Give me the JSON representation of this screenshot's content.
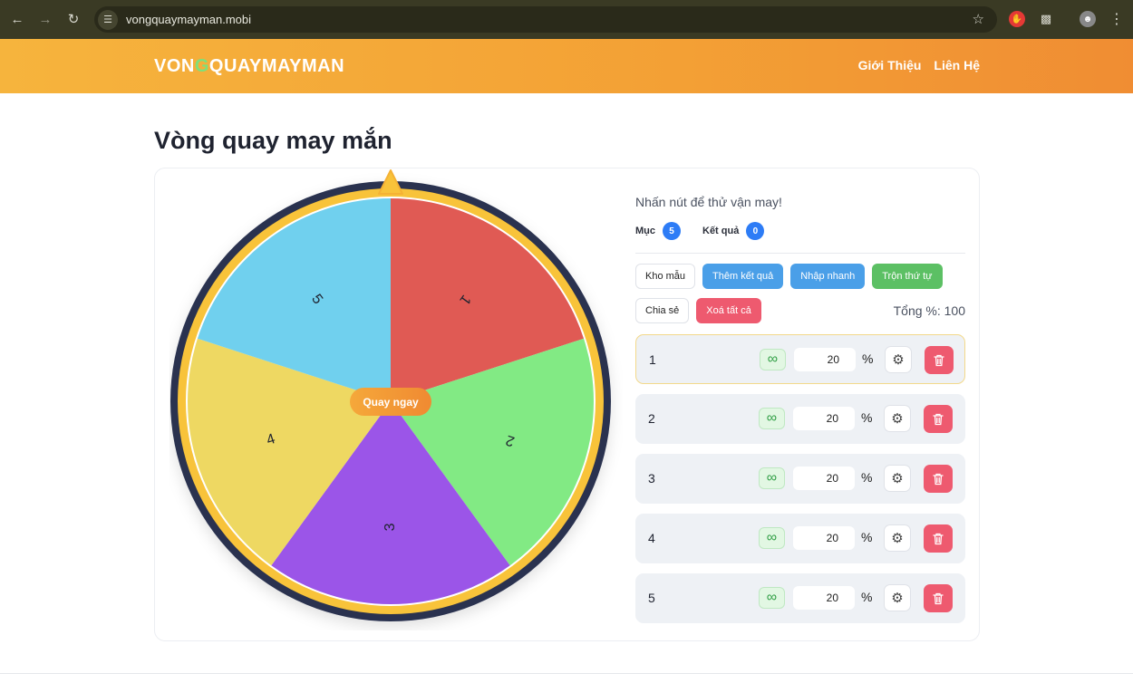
{
  "browser": {
    "url": "vongquaymayman.mobi",
    "back_icon": "arrow-left-icon",
    "forward_icon": "arrow-right-icon",
    "reload_icon": "reload-icon"
  },
  "header": {
    "logo_part1": "VON",
    "logo_accent": "G",
    "logo_part2": "QUAYMAYMAN",
    "nav": [
      "Giới Thiệu",
      "Liên Hệ"
    ]
  },
  "page": {
    "title": "Vòng quay may mắn"
  },
  "wheel": {
    "spin_label": "Quay ngay",
    "segments": [
      {
        "label": "1",
        "color": "#e05a54"
      },
      {
        "label": "2",
        "color": "#82ea84"
      },
      {
        "label": "3",
        "color": "#9b55e8"
      },
      {
        "label": "4",
        "color": "#eed862"
      },
      {
        "label": "5",
        "color": "#70d0ee"
      }
    ],
    "rim_color": "#f8c33a",
    "outer_color": "#2b3350"
  },
  "panel": {
    "tagline": "Nhấn nút để thử vận may!",
    "items_label": "Mục",
    "items_count": "5",
    "results_label": "Kết quả",
    "results_count": "0",
    "buttons": {
      "library": "Kho mẫu",
      "add_result": "Thêm kết quả",
      "quick_input": "Nhập nhanh",
      "shuffle": "Trộn thứ tự",
      "share": "Chia sẻ",
      "clear_all": "Xoá tất cả"
    },
    "total": "Tổng %: 100",
    "percent_sign": "%",
    "items": [
      {
        "label": "1",
        "percent": "20"
      },
      {
        "label": "2",
        "percent": "20"
      },
      {
        "label": "3",
        "percent": "20"
      },
      {
        "label": "4",
        "percent": "20"
      },
      {
        "label": "5",
        "percent": "20"
      }
    ]
  }
}
